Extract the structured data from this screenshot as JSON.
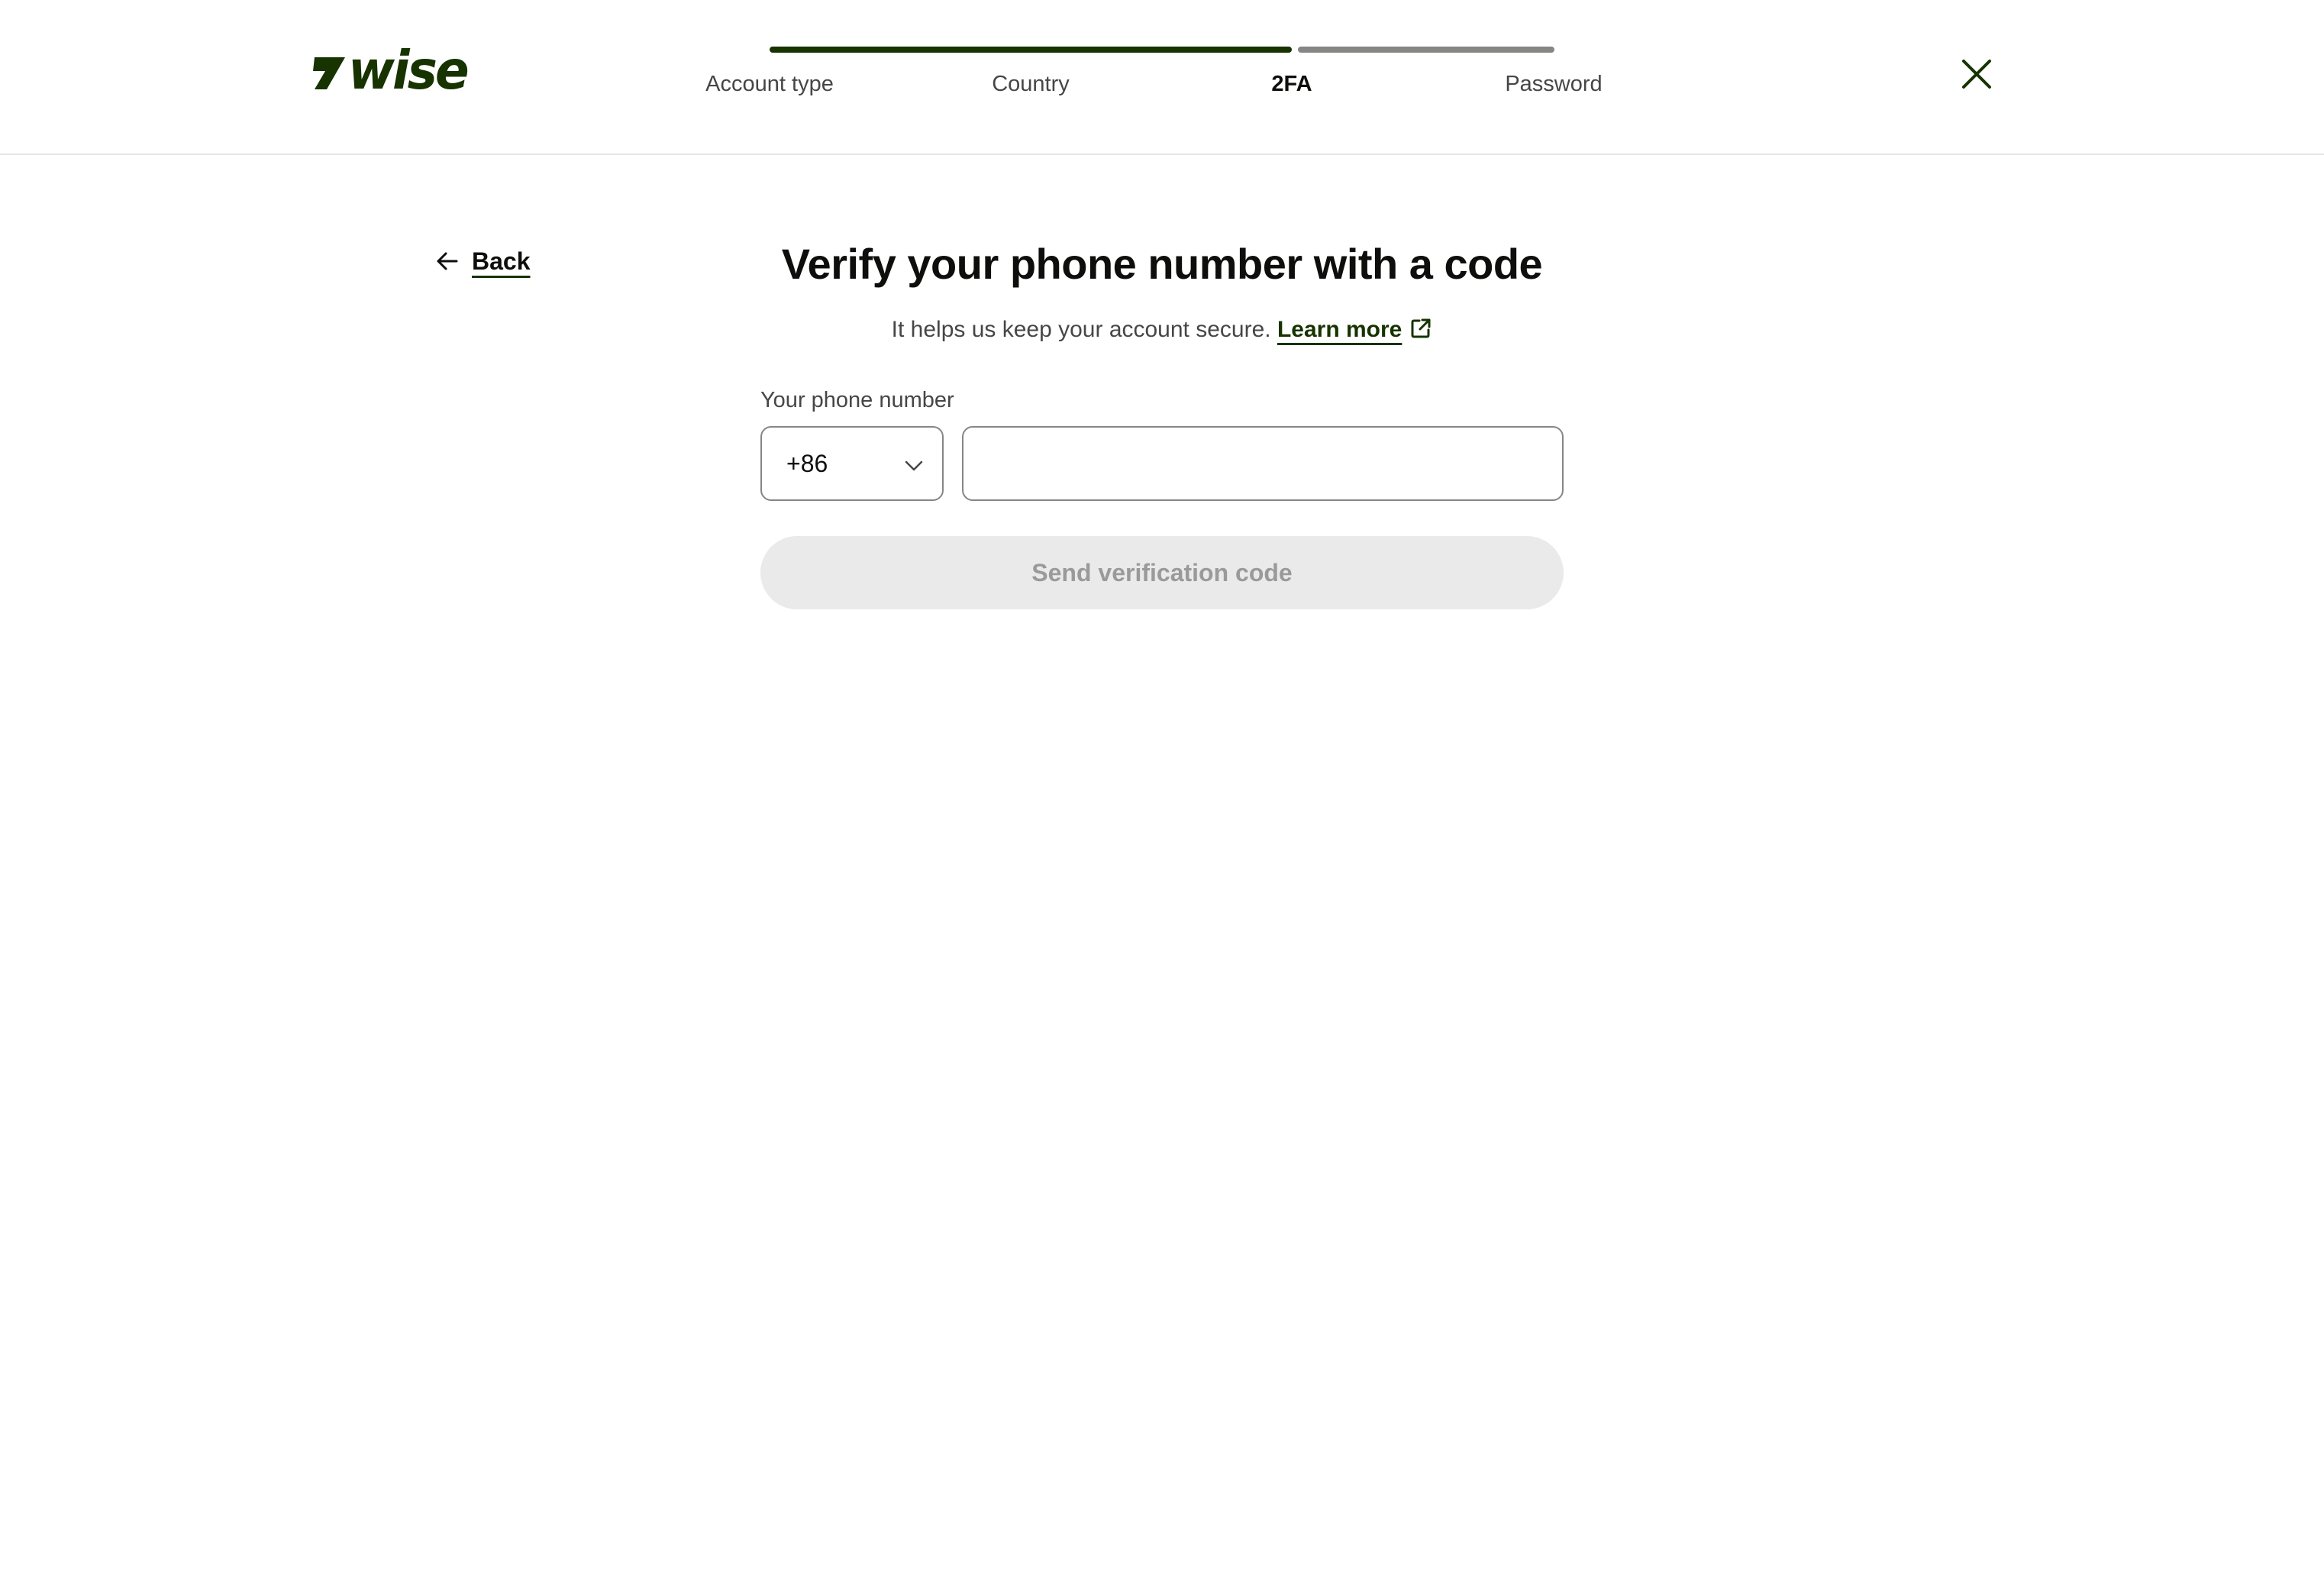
{
  "brand": {
    "name": "wise",
    "color": "#163300"
  },
  "stepper": {
    "steps": [
      {
        "label": "Account type",
        "state": "done"
      },
      {
        "label": "Country",
        "state": "done"
      },
      {
        "label": "2FA",
        "state": "current"
      },
      {
        "label": "Password",
        "state": "todo"
      }
    ],
    "progress_done_color": "#163300",
    "progress_todo_color": "#868685"
  },
  "header": {
    "close_icon": "close-icon"
  },
  "back": {
    "label": "Back",
    "icon": "arrow-left-icon"
  },
  "main": {
    "title": "Verify your phone number with a code",
    "subtitle": "It helps us keep your account secure.",
    "learn_more": "Learn more",
    "learn_more_icon": "external-link-icon"
  },
  "form": {
    "phone_label": "Your phone number",
    "country_code": "+86",
    "phone_value": "",
    "submit_label": "Send verification code",
    "submit_disabled": true
  }
}
